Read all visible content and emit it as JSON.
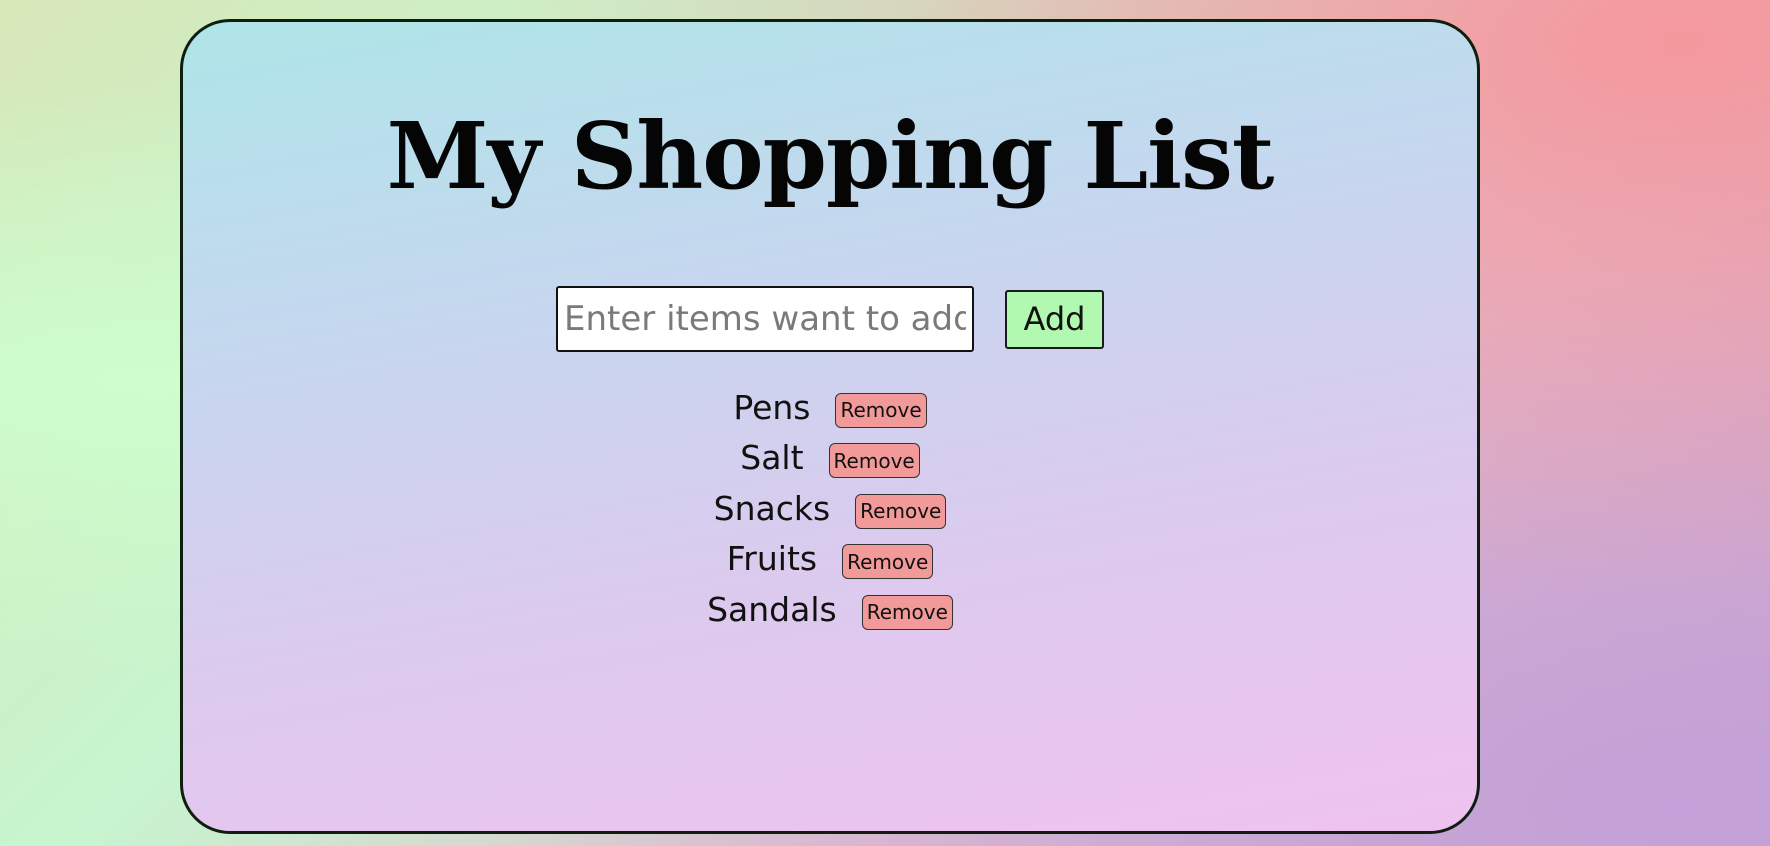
{
  "header": {
    "title": "My Shopping List"
  },
  "entry": {
    "placeholder": "Enter items want to add",
    "value": "",
    "add_label": "Add"
  },
  "list": {
    "items": [
      {
        "label": "Pens",
        "remove_label": "Remove"
      },
      {
        "label": "Salt",
        "remove_label": "Remove"
      },
      {
        "label": "Snacks",
        "remove_label": "Remove"
      },
      {
        "label": "Fruits",
        "remove_label": "Remove"
      },
      {
        "label": "Sandals",
        "remove_label": "Remove"
      }
    ]
  },
  "colors": {
    "add_button": "#b1f9b1",
    "remove_button": "#f29a9a",
    "card_border": "#0f1f0f"
  }
}
